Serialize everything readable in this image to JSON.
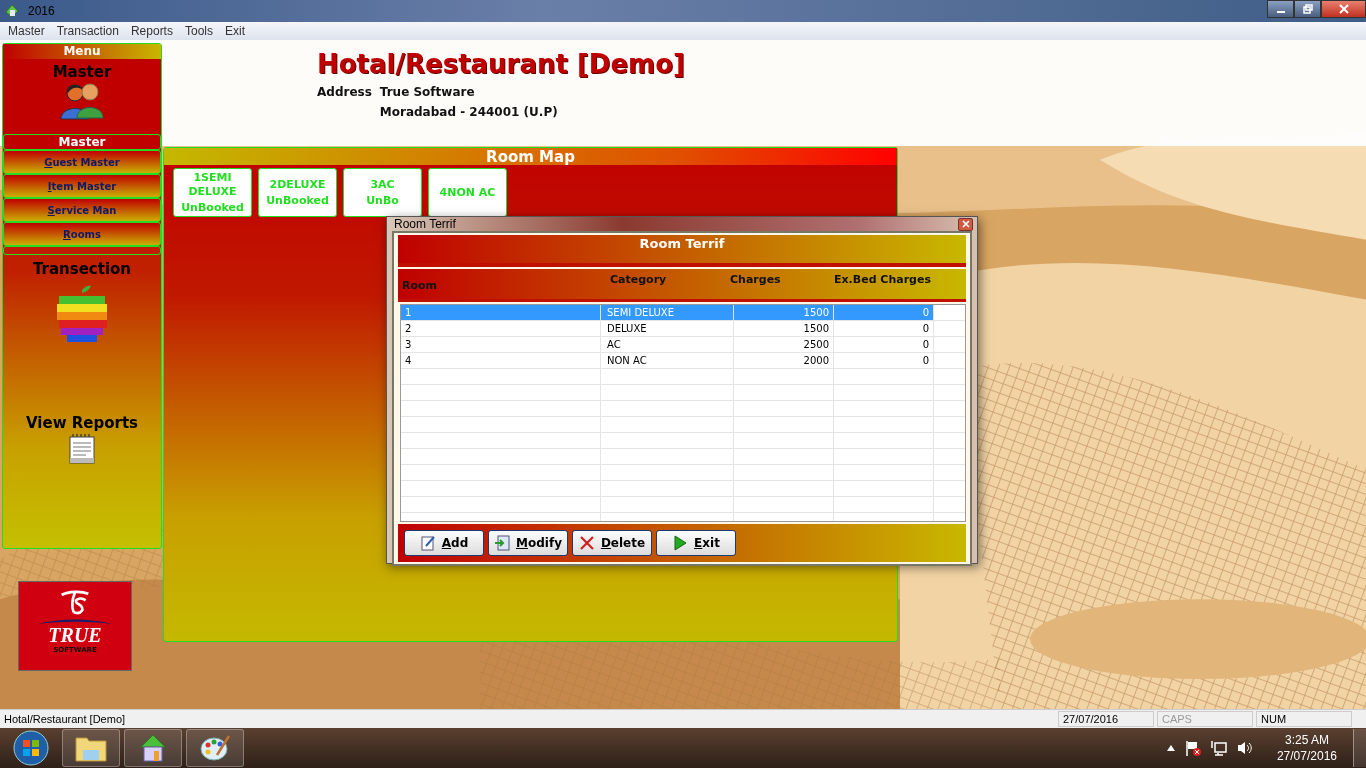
{
  "window": {
    "title": "2016"
  },
  "menu_bar": [
    "Master",
    "Transaction",
    "Reports",
    "Tools",
    "Exit"
  ],
  "sidebar": {
    "header": "Menu",
    "master_title": "Master",
    "master_subheader": "Master",
    "items": [
      {
        "label": "Guest Master"
      },
      {
        "label": "Item Master"
      },
      {
        "label": "Service Man"
      },
      {
        "label": "Rooms"
      }
    ],
    "transaction_title": "Transection",
    "reports_title": "View Reports"
  },
  "logo": {
    "text": "TRUE",
    "subtext": "SOFTWARE"
  },
  "company": {
    "name": "Hotal/Restaurant [Demo]",
    "address_label": "Address",
    "address_lines": [
      "True Software",
      "Moradabad - 244001 (U.P)"
    ]
  },
  "room_map": {
    "title": "Room Map",
    "rooms": [
      {
        "name": "1SEMI DELUXE",
        "status": "UnBooked"
      },
      {
        "name": "2DELUXE",
        "status": "UnBooked"
      },
      {
        "name": "3AC",
        "status": "UnBo"
      },
      {
        "name": "4NON AC"
      }
    ]
  },
  "dialog": {
    "title": "Room Terrif",
    "heading": "Room Terrif",
    "columns": [
      "Room",
      "Category",
      "Charges",
      "Ex.Bed Charges"
    ],
    "rows": [
      {
        "cells": [
          "1",
          "SEMI DELUXE",
          "1500",
          "0"
        ],
        "selected": true
      },
      {
        "cells": [
          "2",
          "DELUXE",
          "1500",
          "0"
        ],
        "selected": false
      },
      {
        "cells": [
          "3",
          "AC",
          "2500",
          "0"
        ],
        "selected": false
      },
      {
        "cells": [
          "4",
          "NON AC",
          "2000",
          "0"
        ],
        "selected": false
      }
    ],
    "buttons": [
      {
        "label": "Add",
        "kind": "edit"
      },
      {
        "label": "Modify",
        "kind": "modify"
      },
      {
        "label": "Delete",
        "kind": "delete"
      },
      {
        "label": "Exit",
        "kind": "play"
      }
    ]
  },
  "status_bar": {
    "text": "Hotal/Restaurant [Demo]",
    "date": "27/07/2016",
    "indicators": [
      {
        "label": "CAPS",
        "active": false
      },
      {
        "label": "NUM",
        "active": true
      }
    ]
  },
  "taskbar": {
    "time": "3:25 AM",
    "date": "27/07/2016"
  }
}
